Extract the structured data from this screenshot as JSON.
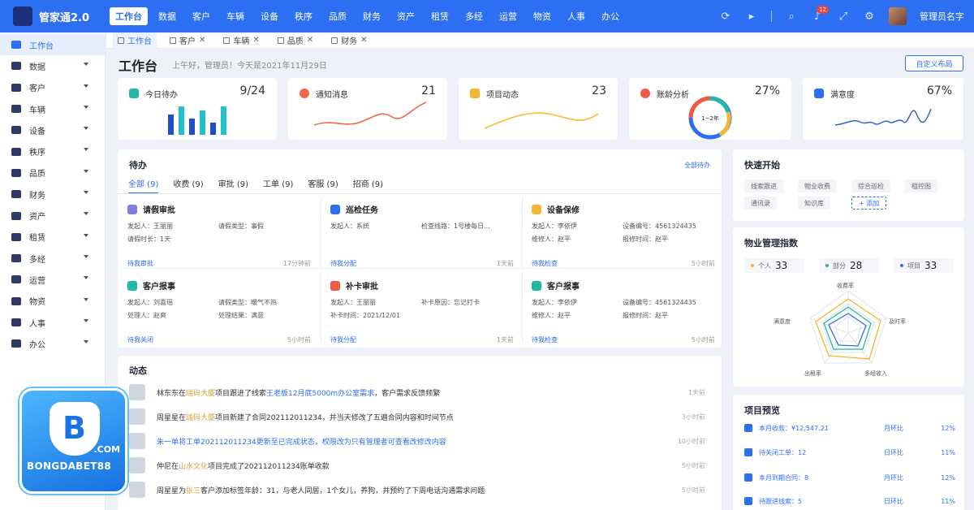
{
  "app": {
    "title": "管家通2.0",
    "user": "管理员名字",
    "notif_count": "12"
  },
  "topnav": [
    "工作台",
    "数据",
    "客户",
    "车辆",
    "设备",
    "秩序",
    "品质",
    "财务",
    "资产",
    "租赁",
    "多经",
    "运营",
    "物资",
    "人事",
    "办公"
  ],
  "sidebar": {
    "items": [
      "工作台",
      "数据",
      "客户",
      "车辆",
      "设备",
      "秩序",
      "品质",
      "财务",
      "资产",
      "租赁",
      "多经",
      "运营",
      "物资",
      "人事",
      "办公"
    ]
  },
  "tabs": [
    "工作台",
    "客户",
    "车辆",
    "品质",
    "财务"
  ],
  "page": {
    "title": "工作台",
    "greeting": "上午好，管理员！今天是2021年11月29日",
    "customize": "自定义布局"
  },
  "stats": [
    {
      "title": "今日待办",
      "value": "9/24",
      "color": "#22b8a8"
    },
    {
      "title": "通知消息",
      "value": "21",
      "color": "#f06a4a"
    },
    {
      "title": "项目动态",
      "value": "23",
      "color": "#f2b632"
    },
    {
      "title": "账龄分析",
      "value": "27%",
      "ring_label": "1~2年",
      "color": "#ef5b45"
    },
    {
      "title": "满意度",
      "value": "67%",
      "color": "#2d6ff2"
    }
  ],
  "todo": {
    "title": "待办",
    "all": "全部待办",
    "tabs": [
      "全部 (9)",
      "收费 (9)",
      "审批 (9)",
      "工单 (9)",
      "客服 (9)",
      "招商 (9)"
    ],
    "cards": [
      {
        "title": "请假审批",
        "color": "#7b7fe0",
        "rows": [
          [
            "发起人：王丽丽",
            "请假类型：事假"
          ],
          [
            "请假时长：1天",
            ""
          ]
        ],
        "action": "待我审批",
        "time": "17分钟前"
      },
      {
        "title": "巡检任务",
        "color": "#2d6ff2",
        "rows": [
          [
            "发起人：系统",
            "检查线路：1号楼每日..."
          ]
        ],
        "action": "待我分配",
        "time": "1天前"
      },
      {
        "title": "设备保修",
        "color": "#f2b632",
        "rows": [
          [
            "发起人：李依伊",
            "设备编号：4561324435"
          ],
          [
            "维修人：赵平",
            "报修时间：赵平"
          ]
        ],
        "action": "待我检查",
        "time": "5小时前"
      },
      {
        "title": "客户报事",
        "color": "#22b8a8",
        "rows": [
          [
            "发起人：刘喜瑶",
            "请假类型：暖气不热"
          ],
          [
            "处理人：赵爽",
            "处理结果：满意"
          ]
        ],
        "action": "待我关闭",
        "time": "5小时前"
      },
      {
        "title": "补卡审批",
        "color": "#ef5b45",
        "rows": [
          [
            "发起人：王丽丽",
            "补卡原因：忘记打卡"
          ],
          [
            "补卡时间：2021/12/01",
            ""
          ]
        ],
        "action": "待我分配",
        "time": "1天前"
      },
      {
        "title": "客户报事",
        "color": "#22b8a8",
        "rows": [
          [
            "发起人：李依伊",
            "设备编号：4561324435"
          ],
          [
            "维修人：赵平",
            "报修时间：赵平"
          ]
        ],
        "action": "待我检查",
        "time": "5小时前"
      }
    ]
  },
  "activity": {
    "title": "动态",
    "items": [
      {
        "pre": "林东东在",
        "hl": "瑞码大厦",
        "mid": "项目跟进了线索",
        "hl2": "王老板12月底5000m办公室需求",
        "post": "，客户需求反馈频繁",
        "time": "1天前"
      },
      {
        "pre": "周星星在",
        "hl": "瑞码大厦",
        "mid": "项目新建了合同202112011234，并当天修改了五遍合同内容和时间节点",
        "hl2": "",
        "post": "",
        "time": "3小时前"
      },
      {
        "pre": "朱一单将工单202112011234更新至已完成状态，权限改为只有管理者可查看改修改内容",
        "hl": "",
        "mid": "",
        "hl2": "",
        "post": "",
        "time": "10小时前"
      },
      {
        "pre": "仲尼在",
        "hl": "山水文化",
        "mid": "项目完成了202112011234账单收款",
        "hl2": "",
        "post": "",
        "time": "5小时前"
      },
      {
        "pre": "周星星为",
        "hl": "张三",
        "mid": "客户添加标签年龄：31，与老人同居，1个女儿，养狗，并预约了下周电话沟通需求问题",
        "hl2": "",
        "post": "",
        "time": "5小时前"
      }
    ]
  },
  "quick": {
    "title": "快速开始",
    "chips": [
      "线索跟进",
      "物业收费",
      "综合巡检",
      "租控图",
      "通讯录",
      "知识库"
    ],
    "add": "+ 添加"
  },
  "index": {
    "title": "物业管理指数",
    "stats": [
      {
        "label": "个人",
        "value": "33",
        "color": "#f2b632"
      },
      {
        "label": "部分",
        "value": "28",
        "color": "#22b8a8"
      },
      {
        "label": "项目",
        "value": "33",
        "color": "#2d6ff2"
      }
    ],
    "axes": [
      "收费率",
      "及时率",
      "多经收入",
      "出租率",
      "满意度"
    ]
  },
  "project": {
    "title": "项目预览",
    "rows": [
      {
        "label": "本月收款：¥12,547.21",
        "cmp": "月环比",
        "pct": "12%"
      },
      {
        "label": "待关闭工单：12",
        "cmp": "日环比",
        "pct": "11%"
      },
      {
        "label": "本月到期合同：8",
        "cmp": "月环比",
        "pct": "12%"
      },
      {
        "label": "待跟进线索：5",
        "cmp": "日环比",
        "pct": "11%"
      }
    ]
  },
  "watermark": {
    "letter": "B",
    "com": ".COM",
    "name": "BONGDABET88"
  },
  "chart_data": {
    "type": "bar",
    "categories": [
      "1",
      "2",
      "3",
      "4",
      "5",
      "6"
    ],
    "series": [
      {
        "values": [
          5,
          7,
          4,
          6,
          3,
          7
        ]
      }
    ],
    "title": "今日待办"
  }
}
